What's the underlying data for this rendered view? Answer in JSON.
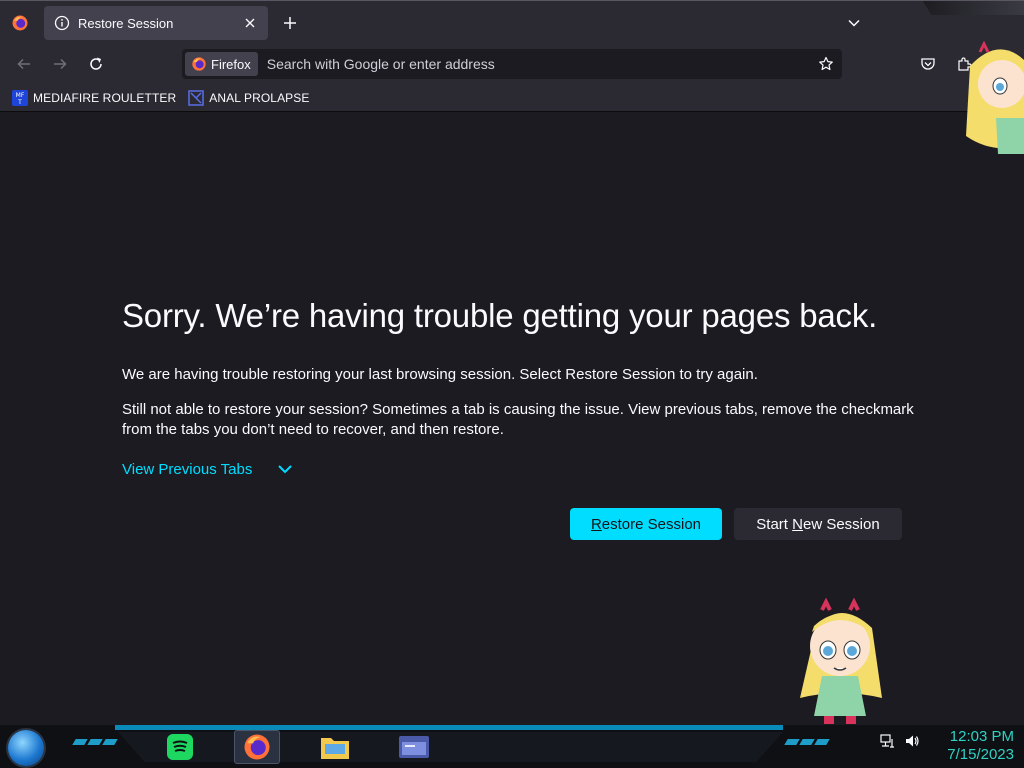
{
  "tabs": [
    {
      "title": "Restore Session"
    }
  ],
  "urlbar": {
    "identity_label": "Firefox",
    "placeholder": "Search with Google or enter address"
  },
  "bookmarks": [
    {
      "label": "MEDIAFIRE ROULETTER",
      "icon": "mediafire-icon"
    },
    {
      "label": "ANAL PROLAPSE",
      "icon": "bookmark-site-icon"
    }
  ],
  "page": {
    "heading": "Sorry. We’re having trouble getting your pages back.",
    "p1": "We are having trouble restoring your last browsing session. Select Restore Session to try again.",
    "p2": "Still not able to restore your session? Sometimes a tab is causing the issue. View previous tabs, remove the checkmark from the tabs you don’t need to recover, and then restore.",
    "view_previous_tabs": "View Previous Tabs",
    "restore_button": {
      "underline": "R",
      "rest": "estore Session"
    },
    "new_session_button": {
      "before": "Start ",
      "underline": "N",
      "after": "ew Session"
    }
  },
  "taskbar": {
    "clock_time": "12:03 PM",
    "clock_date": "7/15/2023"
  },
  "colors": {
    "accent": "#00ddff",
    "background": "#1c1b22",
    "toolbar": "#2b2a33",
    "clock": "#2fd2c4"
  }
}
